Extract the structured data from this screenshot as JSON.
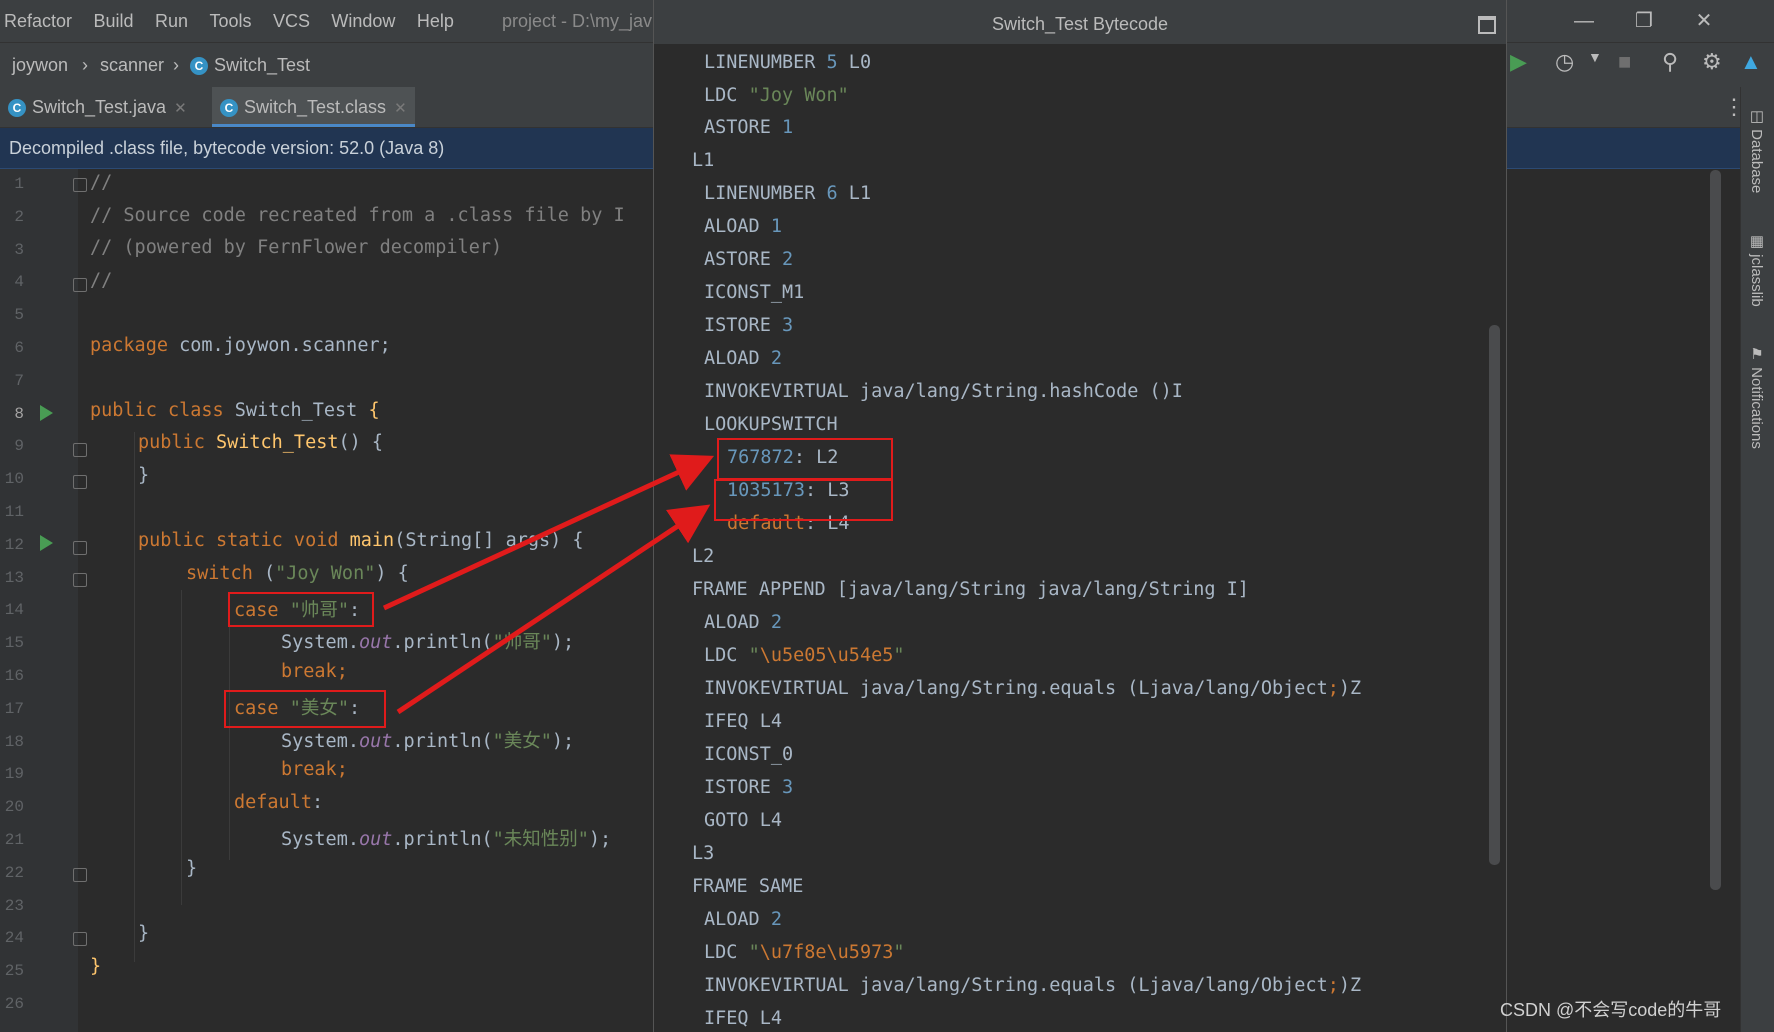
{
  "menu": [
    "Refactor",
    "Build",
    "Run",
    "Tools",
    "VCS",
    "Window",
    "Help"
  ],
  "project_title": "project - D:\\my_jav",
  "breadcrumb": [
    "joywon",
    "scanner",
    "Switch_Test"
  ],
  "tabs": [
    {
      "label": "Switch_Test.java",
      "active": false
    },
    {
      "label": "Switch_Test.class",
      "active": true
    }
  ],
  "banner": "Decompiled .class file, bytecode version: 52.0 (Java 8)",
  "line_numbers": [
    "1",
    "2",
    "3",
    "4",
    "5",
    "6",
    "7",
    "8",
    "9",
    "10",
    "11",
    "12",
    "13",
    "14",
    "15",
    "16",
    "17",
    "18",
    "19",
    "20",
    "21",
    "22",
    "23",
    "24",
    "25",
    "26"
  ],
  "code": {
    "l1": "//",
    "l2": "// Source code recreated from a .class file by I",
    "l3": "// (powered by FernFlower decompiler)",
    "l4": "//",
    "l6_kw": "package",
    "l6_rest": " com.joywon.scanner;",
    "l8_kw": "public class",
    "l8_name": " Switch_Test ",
    "l8_brace": "{",
    "l9_kw": "public",
    "l9_fn": "Switch_Test",
    "l9_rest": "() {",
    "l10": "}",
    "l12_kw": "public static void",
    "l12_fn": "main",
    "l12_rest": "(String[] args) {",
    "l13_kw": "switch",
    "l13_open": " (",
    "l13_str": "\"Joy Won\"",
    "l13_close": ") {",
    "l14_kw": "case",
    "l14_str": "\"帅哥\"",
    "l14_colon": ":",
    "l15_a": "System.",
    "l15_out": "out",
    "l15_b": ".println(",
    "l15_str": "\"帅哥\"",
    "l15_c": ");",
    "l16": "break;",
    "l17_kw": "case",
    "l17_str": "\"美女\"",
    "l17_colon": ":",
    "l18_a": "System.",
    "l18_out": "out",
    "l18_b": ".println(",
    "l18_str": "\"美女\"",
    "l18_c": ");",
    "l19": "break;",
    "l20_kw": "default",
    "l20_colon": ":",
    "l21_a": "System.",
    "l21_out": "out",
    "l21_b": ".println(",
    "l21_str": "\"未知性别\"",
    "l21_c": ");",
    "l22": "}",
    "l24": "}",
    "l25": "}"
  },
  "bytecode": {
    "title": "Switch_Test Bytecode",
    "b1a": "LINENUMBER ",
    "b1n": "5",
    "b1b": " L0",
    "b2a": "LDC ",
    "b2s": "\"Joy Won\"",
    "b3a": "ASTORE ",
    "b3n": "1",
    "b4": "L1",
    "b5a": "LINENUMBER ",
    "b5n": "6",
    "b5b": " L1",
    "b6a": "ALOAD ",
    "b6n": "1",
    "b7a": "ASTORE ",
    "b7n": "2",
    "b8": "ICONST_M1",
    "b9a": "ISTORE ",
    "b9n": "3",
    "b10a": "ALOAD ",
    "b10n": "2",
    "b11": "INVOKEVIRTUAL java/lang/String.hashCode ()I",
    "b12": "LOOKUPSWITCH",
    "b13n": "767872",
    "b13b": ": L2",
    "b14n": "1035173",
    "b14b": ": L3",
    "b15d": "default",
    "b15b": ": L4",
    "b16": "L2",
    "b17": "FRAME APPEND [java/lang/String java/lang/String I]",
    "b18a": "ALOAD ",
    "b18n": "2",
    "b19a": "LDC ",
    "b19q1": "\"",
    "b19e": "\\u5e05\\u54e5",
    "b19q2": "\"",
    "b20a": "INVOKEVIRTUAL java/lang/String.equals (Ljava/lang/Object",
    "b20s": ";",
    "b20b": ")Z",
    "b21": "IFEQ L4",
    "b22": "ICONST_0",
    "b23a": "ISTORE ",
    "b23n": "3",
    "b24": "GOTO L4",
    "b25": "L3",
    "b26": "FRAME SAME",
    "b27a": "ALOAD ",
    "b27n": "2",
    "b28a": "LDC ",
    "b28q1": "\"",
    "b28e": "\\u7f8e\\u5973",
    "b28q2": "\"",
    "b29a": "INVOKEVIRTUAL java/lang/String.equals (Ljava/lang/Object",
    "b29s": ";",
    "b29b": ")Z",
    "b30": "IFEQ L4"
  },
  "right_tabs": [
    "Database",
    "jclasslib",
    "Notifications"
  ],
  "watermark": "CSDN @不会写code的牛哥",
  "colors": {
    "annotation": "#e01b1b",
    "keyword": "#cc7832",
    "string": "#6a8759",
    "number": "#6897bb"
  }
}
